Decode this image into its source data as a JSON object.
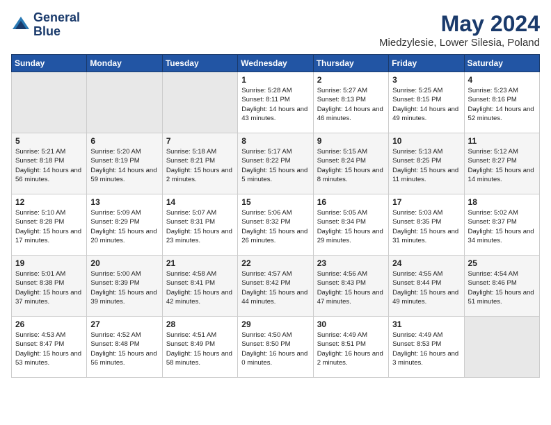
{
  "header": {
    "logo_line1": "General",
    "logo_line2": "Blue",
    "month": "May 2024",
    "location": "Miedzylesie, Lower Silesia, Poland"
  },
  "weekdays": [
    "Sunday",
    "Monday",
    "Tuesday",
    "Wednesday",
    "Thursday",
    "Friday",
    "Saturday"
  ],
  "weeks": [
    [
      {
        "day": "",
        "info": ""
      },
      {
        "day": "",
        "info": ""
      },
      {
        "day": "",
        "info": ""
      },
      {
        "day": "1",
        "info": "Sunrise: 5:28 AM\nSunset: 8:11 PM\nDaylight: 14 hours\nand 43 minutes."
      },
      {
        "day": "2",
        "info": "Sunrise: 5:27 AM\nSunset: 8:13 PM\nDaylight: 14 hours\nand 46 minutes."
      },
      {
        "day": "3",
        "info": "Sunrise: 5:25 AM\nSunset: 8:15 PM\nDaylight: 14 hours\nand 49 minutes."
      },
      {
        "day": "4",
        "info": "Sunrise: 5:23 AM\nSunset: 8:16 PM\nDaylight: 14 hours\nand 52 minutes."
      }
    ],
    [
      {
        "day": "5",
        "info": "Sunrise: 5:21 AM\nSunset: 8:18 PM\nDaylight: 14 hours\nand 56 minutes."
      },
      {
        "day": "6",
        "info": "Sunrise: 5:20 AM\nSunset: 8:19 PM\nDaylight: 14 hours\nand 59 minutes."
      },
      {
        "day": "7",
        "info": "Sunrise: 5:18 AM\nSunset: 8:21 PM\nDaylight: 15 hours\nand 2 minutes."
      },
      {
        "day": "8",
        "info": "Sunrise: 5:17 AM\nSunset: 8:22 PM\nDaylight: 15 hours\nand 5 minutes."
      },
      {
        "day": "9",
        "info": "Sunrise: 5:15 AM\nSunset: 8:24 PM\nDaylight: 15 hours\nand 8 minutes."
      },
      {
        "day": "10",
        "info": "Sunrise: 5:13 AM\nSunset: 8:25 PM\nDaylight: 15 hours\nand 11 minutes."
      },
      {
        "day": "11",
        "info": "Sunrise: 5:12 AM\nSunset: 8:27 PM\nDaylight: 15 hours\nand 14 minutes."
      }
    ],
    [
      {
        "day": "12",
        "info": "Sunrise: 5:10 AM\nSunset: 8:28 PM\nDaylight: 15 hours\nand 17 minutes."
      },
      {
        "day": "13",
        "info": "Sunrise: 5:09 AM\nSunset: 8:29 PM\nDaylight: 15 hours\nand 20 minutes."
      },
      {
        "day": "14",
        "info": "Sunrise: 5:07 AM\nSunset: 8:31 PM\nDaylight: 15 hours\nand 23 minutes."
      },
      {
        "day": "15",
        "info": "Sunrise: 5:06 AM\nSunset: 8:32 PM\nDaylight: 15 hours\nand 26 minutes."
      },
      {
        "day": "16",
        "info": "Sunrise: 5:05 AM\nSunset: 8:34 PM\nDaylight: 15 hours\nand 29 minutes."
      },
      {
        "day": "17",
        "info": "Sunrise: 5:03 AM\nSunset: 8:35 PM\nDaylight: 15 hours\nand 31 minutes."
      },
      {
        "day": "18",
        "info": "Sunrise: 5:02 AM\nSunset: 8:37 PM\nDaylight: 15 hours\nand 34 minutes."
      }
    ],
    [
      {
        "day": "19",
        "info": "Sunrise: 5:01 AM\nSunset: 8:38 PM\nDaylight: 15 hours\nand 37 minutes."
      },
      {
        "day": "20",
        "info": "Sunrise: 5:00 AM\nSunset: 8:39 PM\nDaylight: 15 hours\nand 39 minutes."
      },
      {
        "day": "21",
        "info": "Sunrise: 4:58 AM\nSunset: 8:41 PM\nDaylight: 15 hours\nand 42 minutes."
      },
      {
        "day": "22",
        "info": "Sunrise: 4:57 AM\nSunset: 8:42 PM\nDaylight: 15 hours\nand 44 minutes."
      },
      {
        "day": "23",
        "info": "Sunrise: 4:56 AM\nSunset: 8:43 PM\nDaylight: 15 hours\nand 47 minutes."
      },
      {
        "day": "24",
        "info": "Sunrise: 4:55 AM\nSunset: 8:44 PM\nDaylight: 15 hours\nand 49 minutes."
      },
      {
        "day": "25",
        "info": "Sunrise: 4:54 AM\nSunset: 8:46 PM\nDaylight: 15 hours\nand 51 minutes."
      }
    ],
    [
      {
        "day": "26",
        "info": "Sunrise: 4:53 AM\nSunset: 8:47 PM\nDaylight: 15 hours\nand 53 minutes."
      },
      {
        "day": "27",
        "info": "Sunrise: 4:52 AM\nSunset: 8:48 PM\nDaylight: 15 hours\nand 56 minutes."
      },
      {
        "day": "28",
        "info": "Sunrise: 4:51 AM\nSunset: 8:49 PM\nDaylight: 15 hours\nand 58 minutes."
      },
      {
        "day": "29",
        "info": "Sunrise: 4:50 AM\nSunset: 8:50 PM\nDaylight: 16 hours\nand 0 minutes."
      },
      {
        "day": "30",
        "info": "Sunrise: 4:49 AM\nSunset: 8:51 PM\nDaylight: 16 hours\nand 2 minutes."
      },
      {
        "day": "31",
        "info": "Sunrise: 4:49 AM\nSunset: 8:53 PM\nDaylight: 16 hours\nand 3 minutes."
      },
      {
        "day": "",
        "info": ""
      }
    ]
  ]
}
